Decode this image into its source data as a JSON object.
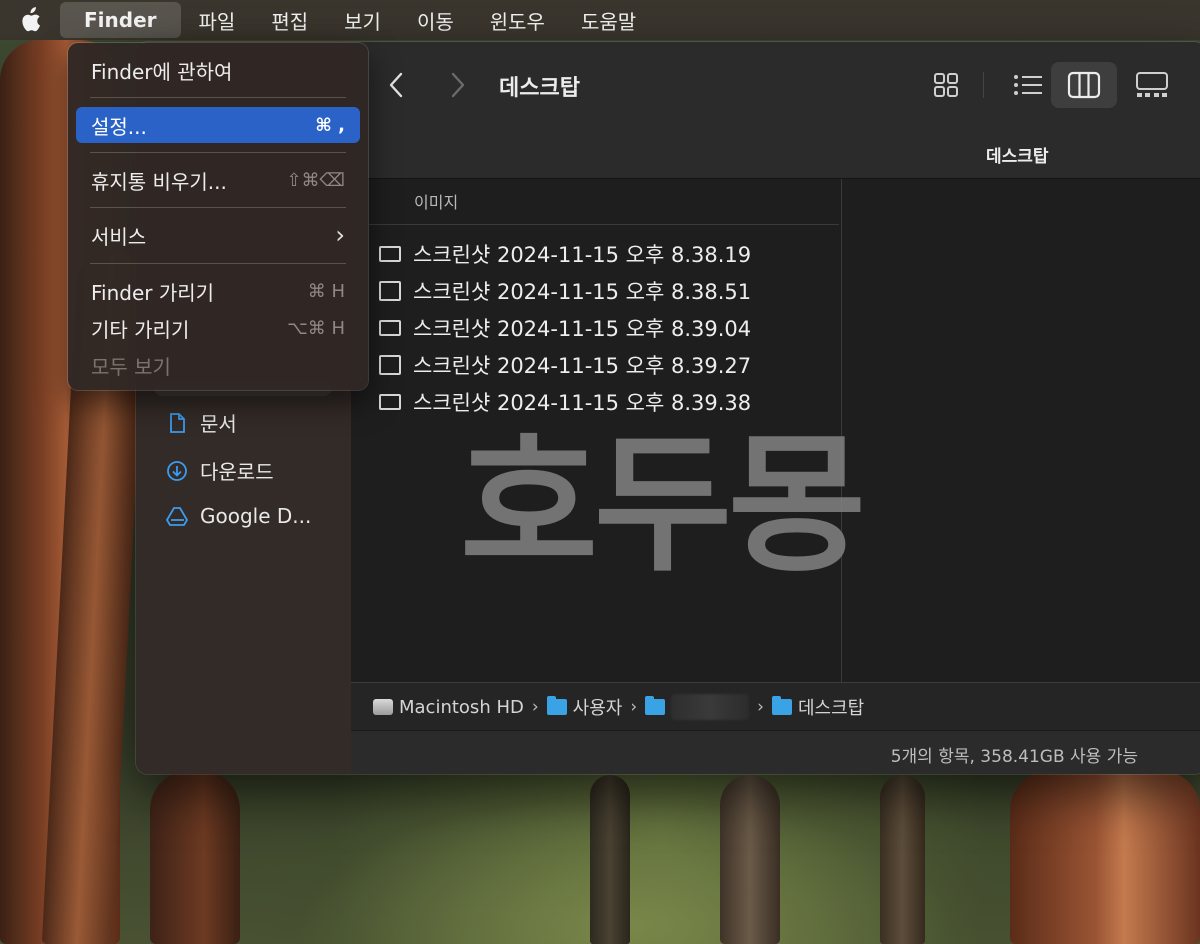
{
  "menubar": {
    "app_name": "Finder",
    "items": [
      "파일",
      "편집",
      "보기",
      "이동",
      "윈도우",
      "도움말"
    ]
  },
  "finder_menu": {
    "about": "Finder에 관하여",
    "settings": {
      "label": "설정...",
      "shortcut": "⌘ ,"
    },
    "empty_trash": {
      "label": "휴지통 비우기...",
      "shortcut": "⇧⌘⌫"
    },
    "services": {
      "label": "서비스",
      "shortcut": "›"
    },
    "hide_finder": {
      "label": "Finder 가리기",
      "shortcut": "⌘ H"
    },
    "hide_others": {
      "label": "기타 가리기",
      "shortcut": "⌥⌘ H"
    },
    "show_all": "모두 보기"
  },
  "window": {
    "title": "데스크탑",
    "tab_title": "데스크탑",
    "column_header": "이미지",
    "files": [
      "스크린샷 2024-11-15 오후 8.38.19",
      "스크린샷 2024-11-15 오후 8.38.51",
      "스크린샷 2024-11-15 오후 8.39.04",
      "스크린샷 2024-11-15 오후 8.39.27",
      "스크린샷 2024-11-15 오후 8.39.38"
    ],
    "sidebar": [
      {
        "label": "문서",
        "icon": "document-icon"
      },
      {
        "label": "다운로드",
        "icon": "download-icon"
      },
      {
        "label": "Google D...",
        "icon": "google-drive-icon"
      }
    ],
    "pathbar": {
      "disk": "Macintosh HD",
      "users": "사용자",
      "desktop": "데스크탑"
    },
    "status": "5개의 항목, 358.41GB 사용 가능",
    "watermark": "호두몽"
  },
  "colors": {
    "menu_selection": "#2a62c7",
    "folder": "#3aa3e6"
  }
}
